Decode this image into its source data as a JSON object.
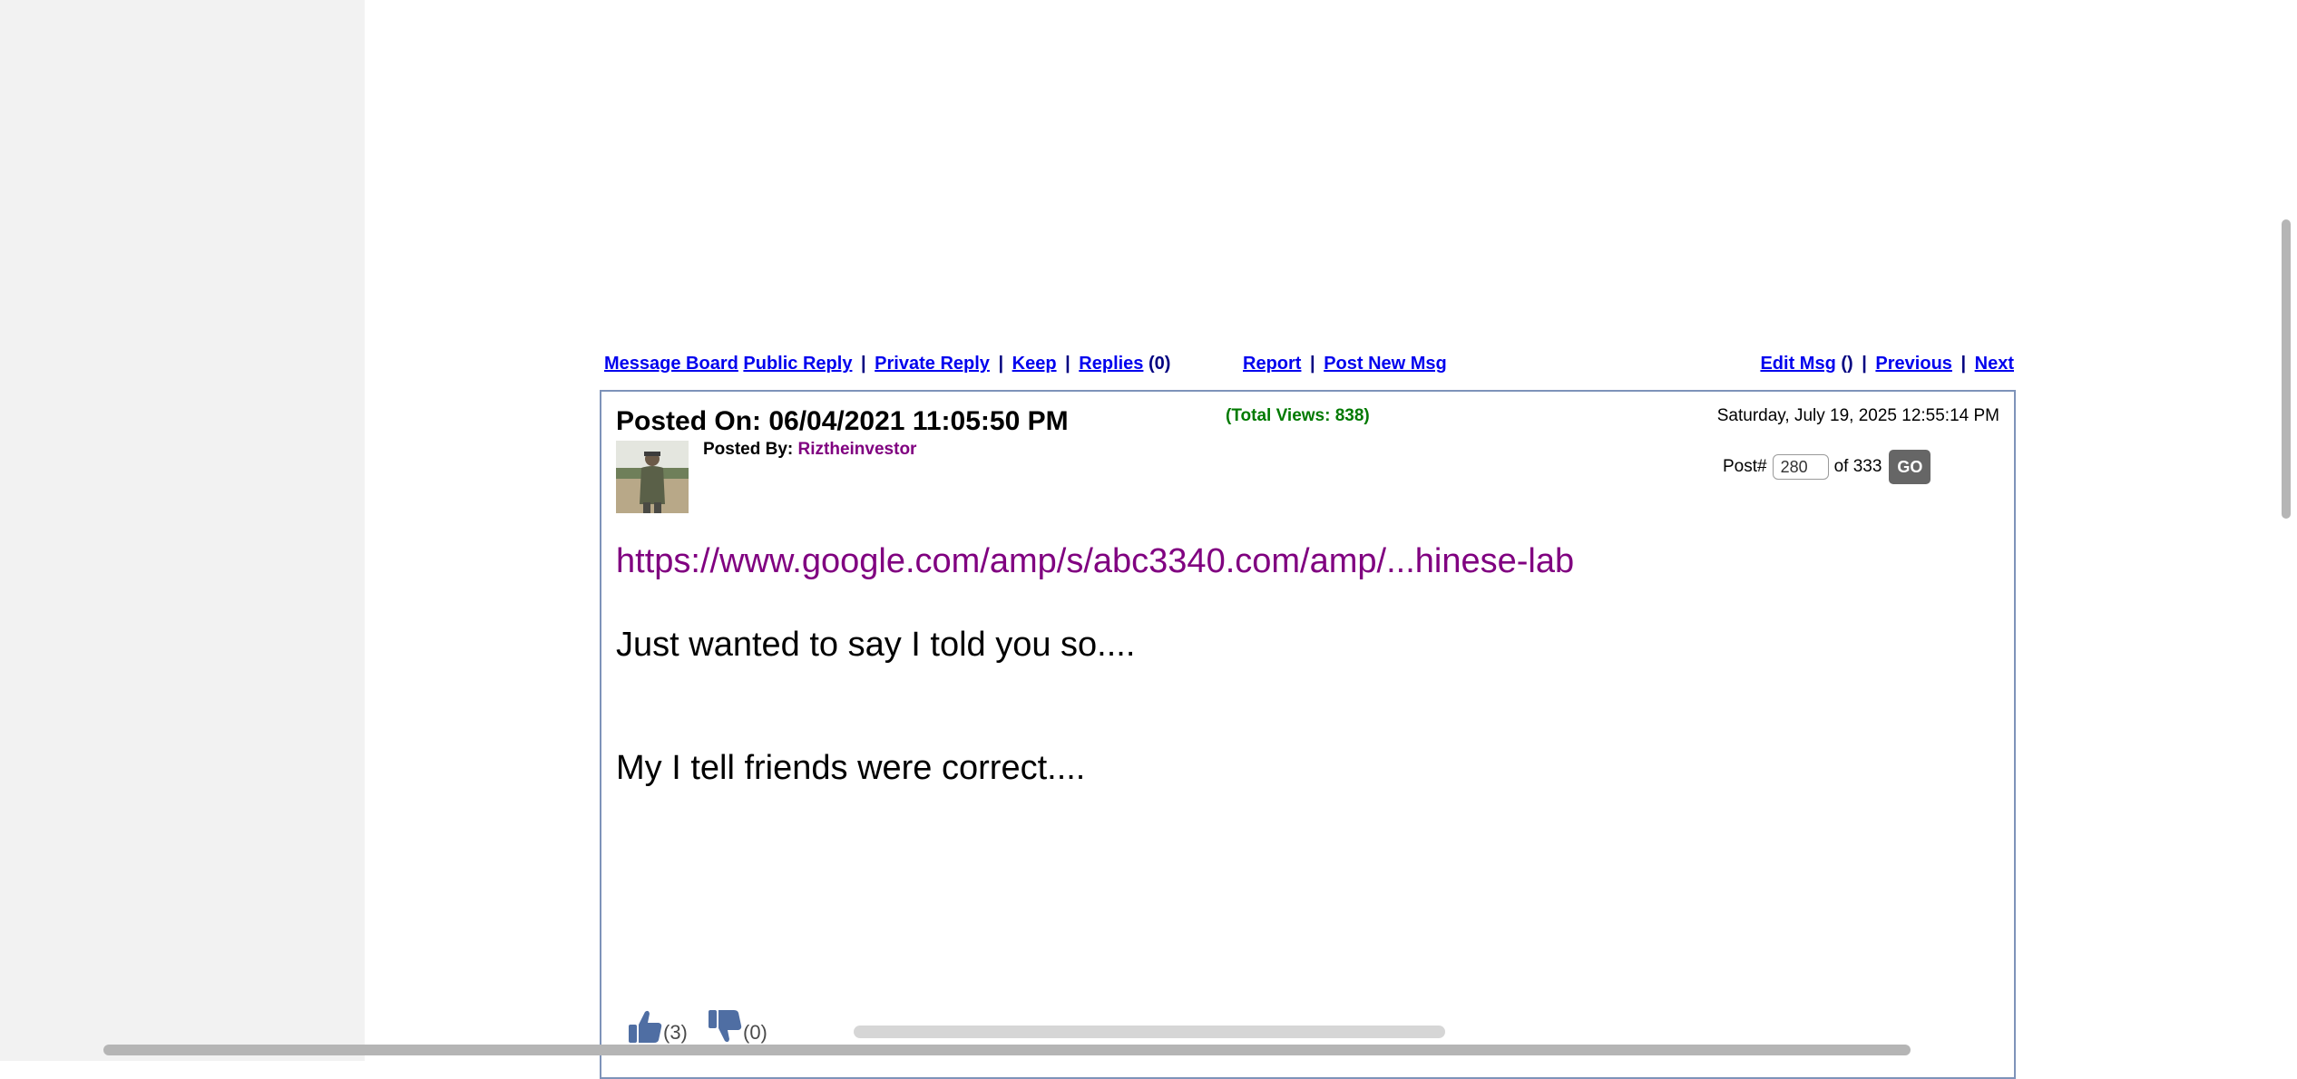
{
  "nav": {
    "message_board": "Message Board",
    "public_reply": "Public Reply",
    "private_reply": "Private Reply",
    "keep": "Keep",
    "replies": "Replies",
    "replies_count": "(0)",
    "report": "Report",
    "post_new_msg": "Post New Msg",
    "edit_msg": "Edit Msg",
    "edit_msg_count": "()",
    "previous": "Previous",
    "next": "Next",
    "separator": "|"
  },
  "post": {
    "posted_on": "Posted On: 06/04/2021 11:05:50 PM",
    "total_views": "(Total Views: 838)",
    "current_date": "Saturday, July 19, 2025 12:55:14 PM",
    "posted_by_label": "Posted By:",
    "author": "Riztheinvestor",
    "post_num_label": "Post#",
    "post_num_value": "280",
    "post_of": "of 333",
    "go_label": "GO",
    "link": "https://www.google.com/amp/s/abc3340.com/amp/...hinese-lab",
    "line1": "Just wanted to say I told you so....",
    "line2": "My I tell friends were correct...."
  },
  "votes": {
    "up_count": "(3)",
    "down_count": "(0)"
  },
  "colors": {
    "link": "#0000ee",
    "visited": "#800080",
    "views_green": "#007a00",
    "box_border": "#7e93b9",
    "thumb_blue": "#4f6ea3"
  },
  "icons": {
    "up": "thumbs-up-icon",
    "down": "thumbs-down-icon"
  }
}
